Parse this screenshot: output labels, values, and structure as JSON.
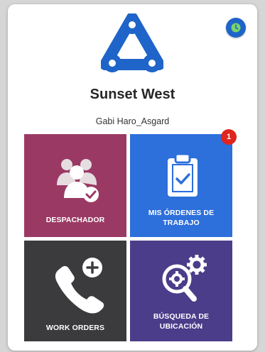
{
  "header": {
    "company_name": "Sunset West",
    "user_name": "Gabi Haro_Asgard",
    "logo_icon": "triangle-nodes-logo-icon",
    "clock_icon": "clock-icon"
  },
  "tiles": [
    {
      "label": "DESPACHADOR",
      "icon": "users-check-icon",
      "color": "#9a3a64"
    },
    {
      "label_line1": "MIS ÓRDENES DE",
      "label_line2": "TRABAJO",
      "icon": "clipboard-check-icon",
      "color": "#2d6fdb",
      "badge": "1"
    },
    {
      "label": "WORK ORDERS",
      "icon": "phone-plus-icon",
      "color": "#3b3b3e"
    },
    {
      "label_line1": "BÚSQUEDA DE",
      "label_line2": "UBICACIÓN",
      "icon": "gear-search-icon",
      "color": "#4b3d89"
    }
  ],
  "colors": {
    "brand_blue": "#1f64c8",
    "badge_red": "#e0241e"
  }
}
